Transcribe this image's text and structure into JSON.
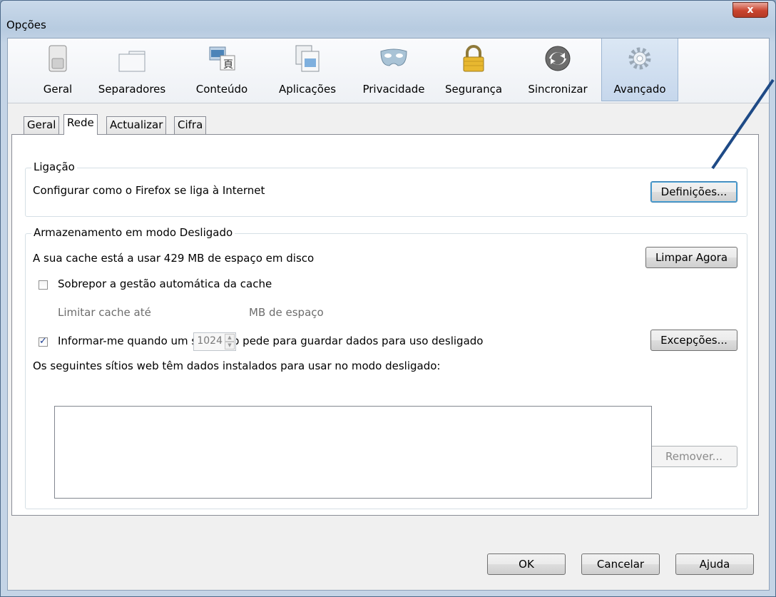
{
  "window": {
    "title": "Opções",
    "close_label": "x"
  },
  "toolbar": {
    "items": [
      {
        "label": "Geral",
        "icon": "switch-icon"
      },
      {
        "label": "Separadores",
        "icon": "tabs-icon"
      },
      {
        "label": "Conteúdo",
        "icon": "content-icon"
      },
      {
        "label": "Aplicações",
        "icon": "applications-icon"
      },
      {
        "label": "Privacidade",
        "icon": "mask-icon"
      },
      {
        "label": "Segurança",
        "icon": "padlock-icon"
      },
      {
        "label": "Sincronizar",
        "icon": "sync-icon"
      },
      {
        "label": "Avançado",
        "icon": "gear-icon"
      }
    ],
    "selected": "Avançado"
  },
  "tabs": {
    "items": [
      "Geral",
      "Rede",
      "Actualizar",
      "Cifra"
    ],
    "selected": "Rede"
  },
  "connection": {
    "title": "Ligação",
    "description": "Configurar como o Firefox se liga à Internet",
    "settings_button": "Definições..."
  },
  "offline": {
    "title": "Armazenamento em modo Desligado",
    "cache_usage": "A sua cache está a usar 429 MB de espaço em disco",
    "clear_button": "Limpar Agora",
    "override_label": "Sobrepor a gestão automática da cache",
    "override_checked": false,
    "limit_label": "Limitar cache até",
    "limit_value": "1024",
    "limit_unit": "MB de espaço",
    "notify_label": "Informar-me quando um sítio web pede para guardar dados para uso desligado",
    "notify_checked": true,
    "exceptions_button": "Excepções...",
    "sites_label": "Os seguintes sítios web têm dados instalados para usar no modo desligado:",
    "remove_button": "Remover..."
  },
  "footer": {
    "ok": "OK",
    "cancel": "Cancelar",
    "help": "Ajuda"
  },
  "colors": {
    "accent": "#3c7fb1",
    "close": "#c9442e",
    "annotation_arrow": "#1e4a86"
  }
}
